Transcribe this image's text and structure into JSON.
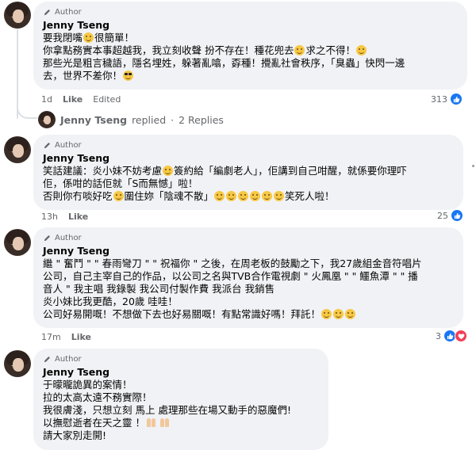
{
  "colors": {
    "bubble_bg": "#f0f2f5",
    "meta_text": "#65676b",
    "like_blue": "#1877f2",
    "love_red": "#f33e58"
  },
  "badge_icon": "pencil-icon",
  "comments": [
    {
      "badge": "Author",
      "name": "Jenny Tseng",
      "lines": [
        [
          "要我閉嘴",
          "emoji:grin",
          "很簡單！"
        ],
        [
          "你拿點務實本事超越我，我立刻收聲 扮不存在！種花兜去",
          "emoji:laugh",
          "求之不得！",
          "emoji:laugh"
        ],
        [
          "那些光是粗言穢語，隱名埋姓，躲著亂噏，孬種！攪亂社會秩序，「臭蟲」快閃一邊"
        ],
        [
          "去，世界不差你！",
          "emoji:cool"
        ]
      ],
      "time": "1d",
      "like_label": "Like",
      "edited_label": "Edited",
      "reactions": "313"
    },
    {
      "badge": "Author",
      "name": "Jenny Tseng",
      "lines": [
        [
          "笑話建議：炎小妹不妨考慮",
          "emoji:think",
          "簽約給「編劇老人」，佢講到自己咁醒，就係要你理吓"
        ],
        [
          "佢，係咁的話佢就「S而無憾」啦！"
        ],
        [
          "否則你冇啖好吃",
          "emoji:yum",
          "圍住妳「陰魂不散」",
          "emoji:laugh",
          "emoji:laugh",
          "emoji:laugh",
          "emoji:laugh",
          "emoji:laugh",
          "emoji:laugh",
          "笑死人啦！"
        ]
      ],
      "time": "13h",
      "like_label": "Like",
      "reactions": "25"
    },
    {
      "badge": "Author",
      "name": "Jenny Tseng",
      "lines": [
        [
          "繼 \" 奮鬥 \" \" 春雨彎刀 \" \" 祝福你 \" 之後，在周老板的鼓勵之下，我27歲組金音符唱片"
        ],
        [
          "公司，自己主宰自己的作品，以公司之名與TVB合作電視劇 \" 火鳳凰 \" \" 鱷魚潭 \" \" 播"
        ],
        [
          "音人 \" 我主唱 我錄製 我公司付製作費 我派台 我銷售"
        ],
        [
          "炎小妹比我更酷，20歲 哇哇！"
        ],
        [
          "公司好易開嘅！不想做下去也好易關嘅！有點常識好嗎！拜託！",
          "emoji:smile",
          "emoji:smile",
          "emoji:smile"
        ]
      ],
      "time": "17m",
      "like_label": "Like",
      "reactions": "3"
    },
    {
      "badge": "Author",
      "name": "Jenny Tseng",
      "lines": [
        [
          "于曚曨詭異的案情！"
        ],
        [
          "拉的太高太遠不務實際！"
        ],
        [
          "我很膚淺，只想立刻 馬上 處理那些在場又動手的惡魔們!"
        ],
        [
          "以撫慰逝者在天之靈 ！",
          "emoji:pray"
        ],
        [
          "請大家別走開!"
        ]
      ]
    }
  ],
  "replies_row": {
    "name": "Jenny Tseng",
    "action": "replied",
    "separator": "·",
    "count": "2 Replies"
  }
}
